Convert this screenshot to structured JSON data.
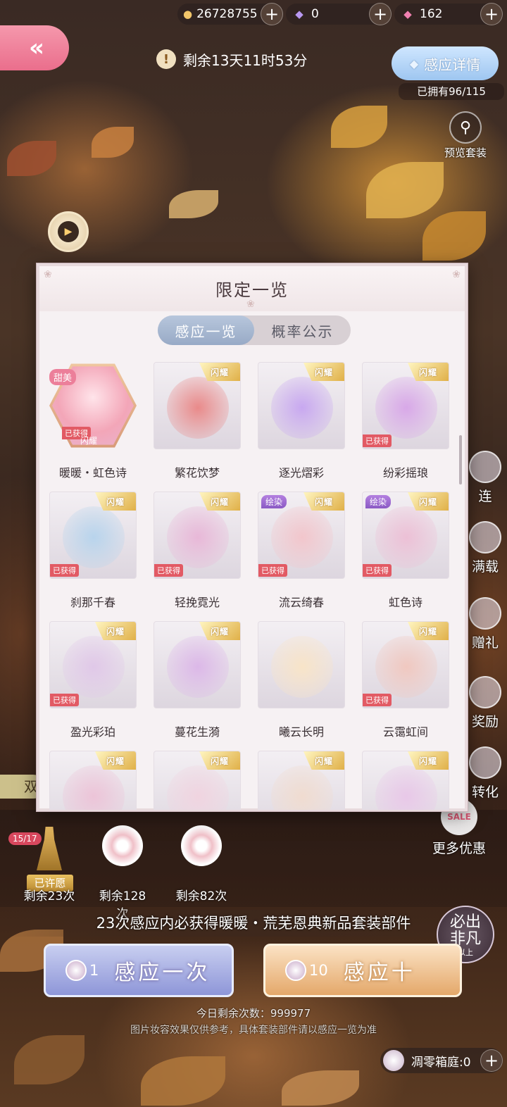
{
  "currencies": [
    {
      "icon": "cat-coin-icon",
      "value": "26728755"
    },
    {
      "icon": "diamond-icon",
      "value": "0"
    },
    {
      "icon": "pink-diamond-icon",
      "value": "162"
    }
  ],
  "header": {
    "back_label": "«",
    "countdown": "剩余13天11时53分",
    "detail_button": "感应详情",
    "owned": "已拥有96/115",
    "preview_label": "预览套装"
  },
  "side_menu": [
    "连",
    "满载",
    "赠礼",
    "奖励",
    "转化"
  ],
  "modal": {
    "title": "限定一览",
    "tabs": [
      {
        "label": "感应一览",
        "active": true
      },
      {
        "label": "概率公示",
        "active": false
      }
    ],
    "items": [
      {
        "name": "暖暖・虹色诗",
        "badge": "闪耀",
        "obtained": true,
        "dye": false,
        "special": "甜美",
        "color": "#f4b6c2"
      },
      {
        "name": "繁花饮梦",
        "badge": "闪耀",
        "obtained": false,
        "dye": false,
        "color": "#e98a8a"
      },
      {
        "name": "逐光熠彩",
        "badge": "闪耀",
        "obtained": false,
        "dye": false,
        "color": "#c8a8f0"
      },
      {
        "name": "纷彩摇琅",
        "badge": "闪耀",
        "obtained": true,
        "dye": false,
        "color": "#d8a8e8"
      },
      {
        "name": "刹那千春",
        "badge": "闪耀",
        "obtained": true,
        "dye": false,
        "color": "#b8d4ec"
      },
      {
        "name": "轻挽霓光",
        "badge": "闪耀",
        "obtained": true,
        "dye": false,
        "color": "#e8b8d8"
      },
      {
        "name": "流云绮春",
        "badge": "闪耀",
        "obtained": true,
        "dye": true,
        "color": "#f2c6cc"
      },
      {
        "name": "虹色诗",
        "badge": "闪耀",
        "obtained": true,
        "dye": true,
        "color": "#ecc0d6"
      },
      {
        "name": "盈光彩珀",
        "badge": "闪耀",
        "obtained": true,
        "dye": false,
        "color": "#e0c8e8"
      },
      {
        "name": "蔓花生漪",
        "badge": "闪耀",
        "obtained": false,
        "dye": false,
        "color": "#dcb8e8"
      },
      {
        "name": "曦云长明",
        "badge": "",
        "obtained": false,
        "dye": false,
        "color": "#f8e4c8"
      },
      {
        "name": "云霭虹间",
        "badge": "闪耀",
        "obtained": true,
        "dye": false,
        "color": "#f0c8c0"
      },
      {
        "name": "",
        "badge": "闪耀",
        "obtained": false,
        "dye": false,
        "color": "#ecc4d8"
      },
      {
        "name": "",
        "badge": "闪耀",
        "obtained": false,
        "dye": false,
        "color": "#f0d4e0"
      },
      {
        "name": "",
        "badge": "闪耀",
        "obtained": false,
        "dye": false,
        "color": "#f0dcd0"
      },
      {
        "name": "",
        "badge": "闪耀",
        "obtained": false,
        "dye": false,
        "color": "#e8c8e8"
      }
    ],
    "obtained_label": "已获得",
    "dye_label": "绘染",
    "hex_bottom_label": "闪耀"
  },
  "left_fragment": "双",
  "wishes": {
    "counter": "15/17",
    "wished_label": "已许愿",
    "items": [
      {
        "label": "剩余23次"
      },
      {
        "label": "剩余128次"
      },
      {
        "label": "剩余82次"
      }
    ]
  },
  "more_deals": {
    "tag": "SALE",
    "label": "更多优惠"
  },
  "guarantee": "23次感应内必获得暖暖・荒芜恩典新品套装部件",
  "rare_badge": {
    "line1": "必出",
    "line2": "非凡",
    "line3": "以上"
  },
  "draw_one": {
    "count": "1",
    "label": "感应一次"
  },
  "draw_ten": {
    "count": "10",
    "label": "感应十"
  },
  "today_remaining": "今日剩余次数：999977",
  "disclaimer": "图片妆容效果仅供参考，具体套装部件请以感应一览为准",
  "garden": {
    "label": "凋零箱庭:0"
  }
}
